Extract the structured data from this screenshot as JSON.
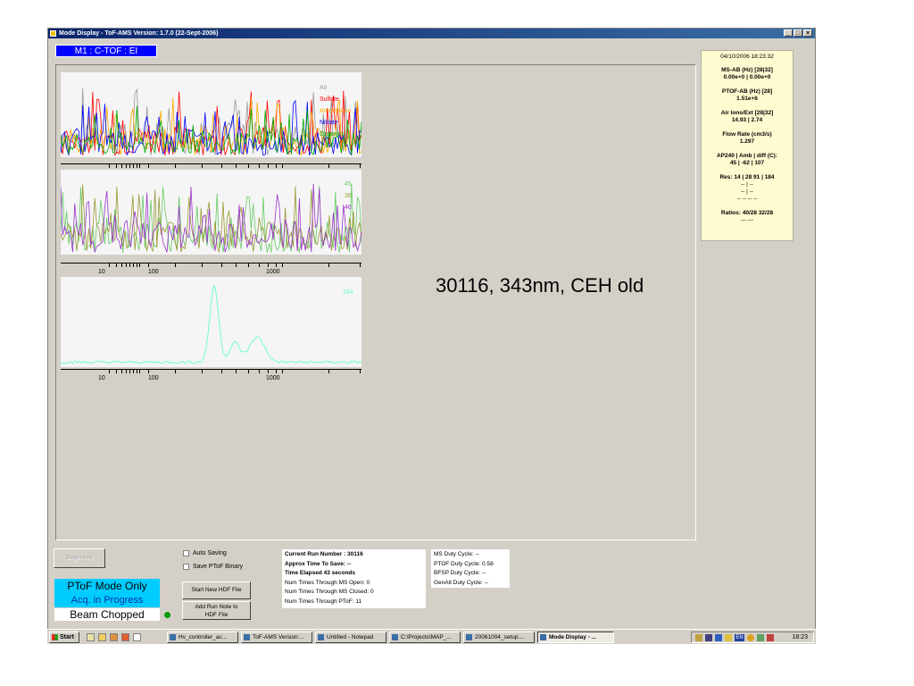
{
  "window": {
    "title": "Mode Display - ToF-AMS Version: 1.7.0 (22-Sept-2006)",
    "controls": [
      "_",
      "□",
      "×"
    ]
  },
  "mode_label": "M1 : C-TOF : EI",
  "annotation": "30116, 343nm, CEH old",
  "plots": {
    "top": {
      "legend": [
        {
          "label": "Air",
          "color": "#999999"
        },
        {
          "label": "Sulfate",
          "color": "#ff0000"
        },
        {
          "label": "Ammonium",
          "color": "#ffaa00"
        },
        {
          "label": "Nitrate",
          "color": "#0000ff"
        },
        {
          "label": "Organics",
          "color": "#00aa00"
        }
      ]
    },
    "middle": {
      "legend": [
        {
          "label": "45",
          "color": "#66cc66"
        },
        {
          "label": "36",
          "color": "#999933"
        },
        {
          "label": "46",
          "color": "#9933cc"
        }
      ]
    },
    "bottom": {
      "legend": [
        {
          "label": "184",
          "color": "#66ffcc"
        }
      ]
    },
    "tick_labels": [
      "10",
      "100",
      "1000"
    ]
  },
  "status_panel": {
    "datetime": "04/10/2006 18:23:32",
    "ms_ab_label": "MS-AB (Hz) [28|32]",
    "ms_ab_value": "0.00e+0 | 0.00e+0",
    "ptof_ab_label": "PTOF-AB (Hz) [28]",
    "ptof_ab_value": "1.51e+6",
    "air_ions_label": "Air Ions/Ext [28|32]",
    "air_ions_value": "14.93 | 2.74",
    "flow_label": "Flow Rate (cm3/s)",
    "flow_value": "1.297",
    "ap240_label": "AP240 | Amb | diff (C):",
    "ap240_value": "45 | -62 | 107",
    "res_label": "Res: 14 | 28  91 | 184",
    "res_line2": "-- | --",
    "res_line3": "-- | --",
    "res_line4": "--  --  --  --",
    "ratios_label": "Ratios: 40/28  32/28",
    "ratios_value": "---  ---"
  },
  "controls": {
    "begin_acq": "Begin Acq",
    "auto_saving": "Auto Saving",
    "save_ptof_binary": "Save PToF Binary",
    "start_new_hdf": "Start New HDF File",
    "add_run_note_1": "Add Run Note to",
    "add_run_note_2": "HDF File",
    "mode_title": "PToF Mode Only",
    "mode_sub": "Acq. in Progress",
    "beam": "Beam Chopped"
  },
  "run_info": {
    "run_number": "Current Run Number : 30116",
    "time_to_save": "Approx Time To Save: --",
    "time_elapsed": "Time Elapsed 43 seconds",
    "ms_open": "Num Times Through MS Open: 0",
    "ms_closed": "Num Times Through MS Closed: 0",
    "ptof": "Num Times Through PToF: 11"
  },
  "duty": {
    "ms": "MS Duty Cycle: --",
    "ptof": "PTOF Duty Cycle: 0.58",
    "bfsp": "BFSP Duty Cycle: --",
    "genalt": "GenAlt Duty Cycle: --"
  },
  "taskbar": {
    "start": "Start",
    "tasks": [
      "Hv_controller_ac...",
      "ToF-AMS Version:...",
      "Untitled - Notepad",
      "C:\\Projects\\MAP_...",
      "20061004_setup....",
      "Mode Display - ..."
    ],
    "tray_lang": "EN",
    "clock": "18:23"
  }
}
